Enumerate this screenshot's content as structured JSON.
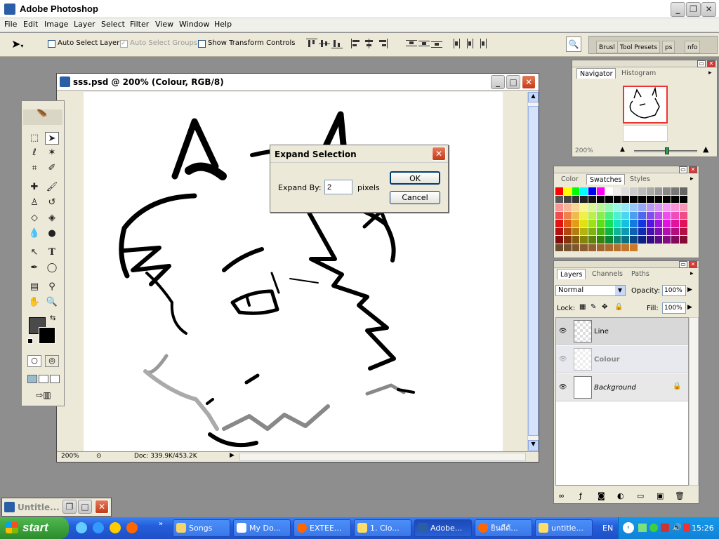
{
  "app": {
    "title": "Adobe Photoshop",
    "menus": [
      "File",
      "Edit",
      "Image",
      "Layer",
      "Select",
      "Filter",
      "View",
      "Window",
      "Help"
    ]
  },
  "options_bar": {
    "auto_select_layer": "Auto Select Layer",
    "auto_select_groups": "Auto Select Groups",
    "show_transform_controls": "Show Transform Controls",
    "auto_select_layer_checked": false,
    "auto_select_groups_checked": true,
    "show_transform_controls_checked": false,
    "palette_well_tabs": [
      "Brusl",
      "Tool Presets",
      "ps",
      "nfo"
    ]
  },
  "document": {
    "title": "sss.psd @ 200% (Colour, RGB/8)",
    "zoom": "200%",
    "doc_info": "Doc: 339.9K/453.2K"
  },
  "dialog": {
    "title": "Expand Selection",
    "label": "Expand By:",
    "value": "2",
    "unit": "pixels",
    "ok": "OK",
    "cancel": "Cancel"
  },
  "navigator": {
    "tabs": [
      "Navigator",
      "Histogram"
    ],
    "zoom": "200%"
  },
  "swatches": {
    "tabs": [
      "Color",
      "Swatches",
      "Styles"
    ]
  },
  "layers": {
    "tabs": [
      "Layers",
      "Channels",
      "Paths"
    ],
    "blend_mode": "Normal",
    "opacity_label": "Opacity:",
    "opacity": "100%",
    "lock_label": "Lock:",
    "fill_label": "Fill:",
    "fill": "100%",
    "items": [
      {
        "name": "Line",
        "visible": true
      },
      {
        "name": "Colour",
        "visible": true
      },
      {
        "name": "Background",
        "visible": true
      }
    ]
  },
  "minimized_window": {
    "title": "Untitle..."
  },
  "taskbar": {
    "start": "start",
    "tasks": [
      "Songs",
      "My Do...",
      "EXTEE...",
      "1. Clo...",
      "Adobe...",
      "ยินดีต้...",
      "untitle..."
    ],
    "language": "EN",
    "clock": "15:26"
  }
}
